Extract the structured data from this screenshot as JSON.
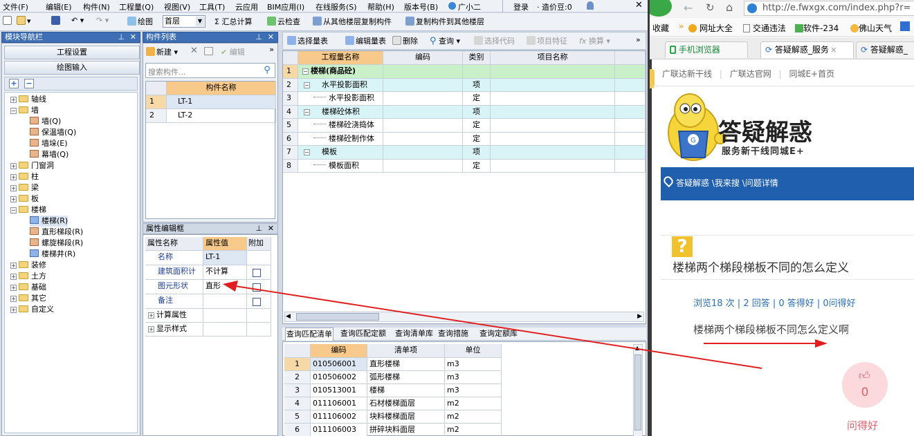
{
  "app": {
    "menu": [
      "文件(F)",
      "编辑(E)",
      "构件(N)",
      "工程量(Q)",
      "视图(V)",
      "工具(T)",
      "云应用",
      "BIM应用(I)",
      "在线服务(S)",
      "帮助(H)",
      "版本号(B)",
      "广小二"
    ],
    "login": "登录",
    "price": "· 造价豆:0",
    "toolbar": {
      "draw": "绘图",
      "floor": "首层",
      "sum": "Σ 汇总计算",
      "cloud_check": "云检查",
      "copy_from": "从其他楼层复制构件",
      "copy_to": "复制构件到其他楼层"
    },
    "nav_panel": {
      "title": "模块导航栏",
      "btn_settings": "工程设置",
      "btn_draw": "绘图输入"
    },
    "tree": [
      {
        "label": "轴线",
        "level": 0,
        "exp": "+"
      },
      {
        "label": "墙",
        "level": 0,
        "exp": "-"
      },
      {
        "label": "墙(Q)",
        "level": 1
      },
      {
        "label": "保温墙(Q)",
        "level": 1
      },
      {
        "label": "墙垛(E)",
        "level": 1
      },
      {
        "label": "幕墙(Q)",
        "level": 1
      },
      {
        "label": "门窗洞",
        "level": 0,
        "exp": "+"
      },
      {
        "label": "柱",
        "level": 0,
        "exp": "+"
      },
      {
        "label": "梁",
        "level": 0,
        "exp": "+"
      },
      {
        "label": "板",
        "level": 0,
        "exp": "+"
      },
      {
        "label": "楼梯",
        "level": 0,
        "exp": "-"
      },
      {
        "label": "楼梯(R)",
        "level": 1
      },
      {
        "label": "直形梯段(R)",
        "level": 1
      },
      {
        "label": "螺旋梯段(R)",
        "level": 1
      },
      {
        "label": "楼梯井(R)",
        "level": 1
      },
      {
        "label": "装修",
        "level": 0,
        "exp": "+"
      },
      {
        "label": "土方",
        "level": 0,
        "exp": "+"
      },
      {
        "label": "基础",
        "level": 0,
        "exp": "+"
      },
      {
        "label": "其它",
        "level": 0,
        "exp": "+"
      },
      {
        "label": "自定义",
        "level": 0,
        "exp": "+"
      }
    ],
    "component_list": {
      "title": "构件列表",
      "new": "新建",
      "edit": "编辑",
      "search_placeholder": "搜索构件...",
      "header": "构件名称",
      "rows": [
        {
          "n": "1",
          "name": "LT-1"
        },
        {
          "n": "2",
          "name": "LT-2"
        }
      ]
    },
    "property_panel": {
      "title": "属性编辑框",
      "headers": [
        "属性名称",
        "属性值",
        "附加"
      ],
      "rows": [
        {
          "name": "名称",
          "value": "LT-1",
          "check": false
        },
        {
          "name": "建筑面积计",
          "value": "不计算",
          "check": true
        },
        {
          "name": "图元形状",
          "value": "直形",
          "check": true
        },
        {
          "name": "备注",
          "value": "",
          "check": true
        }
      ],
      "groups": [
        "计算属性",
        "显示样式"
      ]
    },
    "qty_toolbar": {
      "select": "选择量表",
      "edit": "编辑量表",
      "delete": "删除",
      "query": "查询",
      "select_code": "选择代码",
      "item_feature": "项目特征",
      "calc": "换算"
    },
    "qty_table": {
      "headers": [
        "工程量名称",
        "编码",
        "类别",
        "项目名称"
      ],
      "rows": [
        {
          "n": "1",
          "name": "楼梯(商品砼)",
          "code": "",
          "type": "",
          "item": ""
        },
        {
          "n": "2",
          "name": "水平投影面积",
          "code": "",
          "type": "项",
          "item": ""
        },
        {
          "n": "3",
          "name": "水平投影面积",
          "code": "",
          "type": "定",
          "item": ""
        },
        {
          "n": "4",
          "name": "楼梯砼体积",
          "code": "",
          "type": "项",
          "item": ""
        },
        {
          "n": "5",
          "name": "楼梯砼浇捣体",
          "code": "",
          "type": "定",
          "item": ""
        },
        {
          "n": "6",
          "name": "楼梯砼制作体",
          "code": "",
          "type": "定",
          "item": ""
        },
        {
          "n": "7",
          "name": "模板",
          "code": "",
          "type": "项",
          "item": ""
        },
        {
          "n": "8",
          "name": "模板面积",
          "code": "",
          "type": "定",
          "item": ""
        }
      ]
    },
    "bottom_tabs": [
      "查询匹配清单",
      "查询匹配定额",
      "查询清单库",
      "查询措施",
      "查询定额库"
    ],
    "match_table": {
      "headers": [
        "编码",
        "清单项",
        "单位"
      ],
      "rows": [
        {
          "n": "1",
          "code": "010506001",
          "item": "直形楼梯",
          "unit": "m3"
        },
        {
          "n": "2",
          "code": "010506002",
          "item": "弧形楼梯",
          "unit": "m3"
        },
        {
          "n": "3",
          "code": "010513001",
          "item": "楼梯",
          "unit": "m3"
        },
        {
          "n": "4",
          "code": "011106001",
          "item": "石材楼梯面层",
          "unit": "m2"
        },
        {
          "n": "5",
          "code": "011106002",
          "item": "块料楼梯面层",
          "unit": "m2"
        },
        {
          "n": "6",
          "code": "011106003",
          "item": "拼碎块料面层",
          "unit": "m2"
        }
      ]
    }
  },
  "browser": {
    "url": "http://e.fwxgx.com/index.php?r=",
    "bookmarks": [
      "收藏",
      "网址大全",
      "交通违法",
      "软件-234",
      "佛山天气"
    ],
    "tabs": [
      "手机浏览器",
      "答疑解惑_服务",
      "答疑解惑_"
    ],
    "links": [
      "广联达新干线",
      "广联达官网",
      "同城E+首页"
    ],
    "logo_title": "答疑解惑",
    "logo_sub": "服务新干线同城E+",
    "breadcrumb": "答疑解惑 \\我来搜 \\问题详情",
    "question_title": "楼梯两个梯段梯板不同的怎么定义",
    "stats": "浏览18 次 | 2 回答 | 0 答得好 | 0问得好",
    "body": "楼梯两个梯段梯板不同怎么定义啊",
    "like_count": "0",
    "like_label": "问得好"
  },
  "colors": {
    "arrow": "#e02020",
    "accent_blue": "#2b5ba8",
    "header_orange": "#f7c98a"
  }
}
